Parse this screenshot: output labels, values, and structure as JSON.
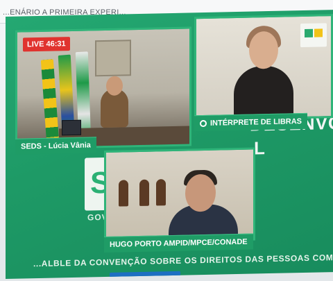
{
  "page": {
    "title": "...ENÁRIO A PRIMEIRA EXPERI..."
  },
  "stream": {
    "live_badge": "LIVE 46:31",
    "background_text_line1": "DESENVOLVIME",
    "background_text_line2": "L",
    "background_text_gov": "GOV",
    "background_block_letter": "S",
    "ticker_text": "...ALBLE DA CONVENÇÃO SOBRE OS DIREITOS DAS PESSOAS COM DEFICIÊNCIA DIANT"
  },
  "participants": [
    {
      "name_label": "SEDS - Lúcia Vânia"
    },
    {
      "name_label": "INTÉRPRETE DE LIBRAS"
    },
    {
      "name_label": "HUGO PORTO AMPID/MPCE/CONADE"
    }
  ],
  "colors": {
    "stream_green": "#1e9a66",
    "live_red": "#e0332f",
    "plate_green": "#1f9c66"
  },
  "icons": [
    "libras-hands-icon",
    "gov-logo-icon"
  ]
}
